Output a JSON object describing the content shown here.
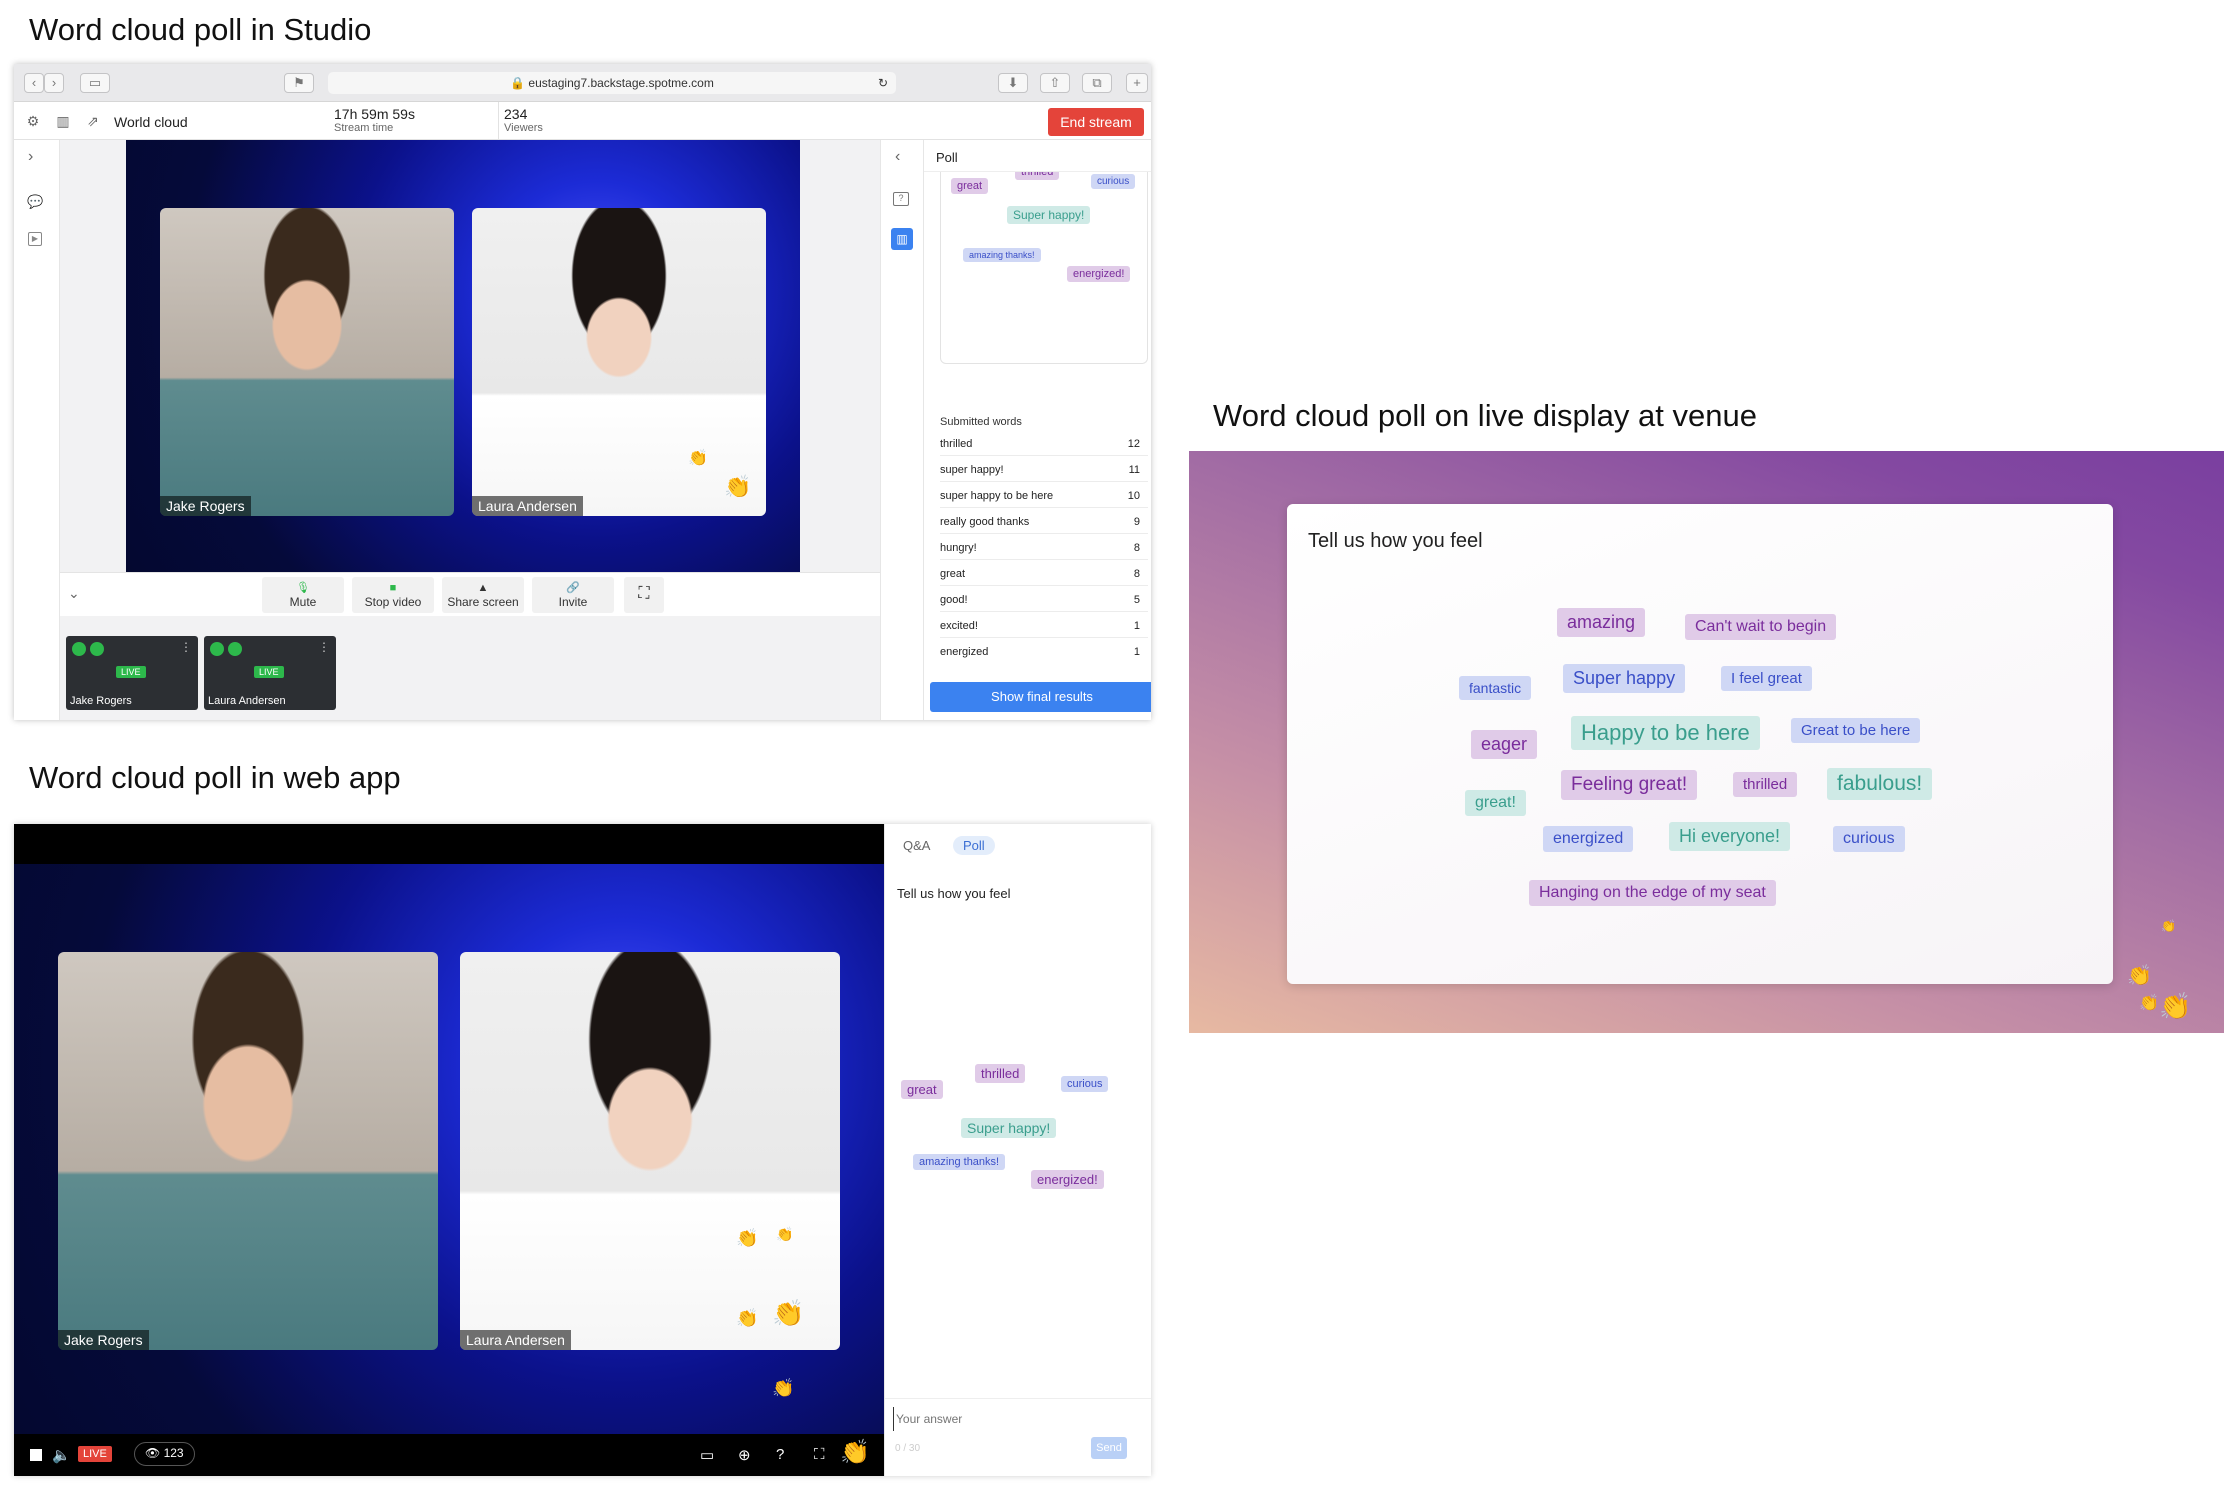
{
  "titles": {
    "studio": "Word cloud poll in Studio",
    "webapp": "Word cloud poll in web app",
    "venue": "Word cloud poll on live display at venue"
  },
  "studio": {
    "url": "eustaging7.backstage.spotme.com",
    "page_title": "World cloud",
    "stream_time": "17h 59m 59s",
    "stream_time_label": "Stream time",
    "viewers": "234",
    "viewers_label": "Viewers",
    "end_stream": "End stream",
    "participants": [
      "Jake Rogers",
      "Laura Andersen"
    ],
    "controls": {
      "mute": "Mute",
      "stop_video": "Stop video",
      "share_screen": "Share screen",
      "invite": "Invite"
    },
    "live_badge": "LIVE",
    "panel_title": "Poll",
    "cloud_words": [
      "great",
      "thrilled",
      "curious",
      "Super happy!",
      "amazing thanks!",
      "energized!"
    ],
    "submitted_header": "Submitted words",
    "submitted": [
      {
        "word": "thrilled",
        "count": "12"
      },
      {
        "word": "super happy!",
        "count": "11"
      },
      {
        "word": "super happy to be here",
        "count": "10"
      },
      {
        "word": "really good thanks",
        "count": "9"
      },
      {
        "word": "hungry!",
        "count": "8"
      },
      {
        "word": "great",
        "count": "8"
      },
      {
        "word": "good!",
        "count": "5"
      },
      {
        "word": "excited!",
        "count": "1"
      },
      {
        "word": "energized",
        "count": "1"
      }
    ],
    "final_button": "Show final results"
  },
  "webapp": {
    "participants": [
      "Jake Rogers",
      "Laura Andersen"
    ],
    "live_badge": "LIVE",
    "viewer_count": "123",
    "tabs": [
      "Q&A",
      "Poll"
    ],
    "question": "Tell us how you feel",
    "cloud_words": [
      "great",
      "thrilled",
      "curious",
      "Super happy!",
      "amazing thanks!",
      "energized!"
    ],
    "answer_placeholder": "Your answer",
    "char_count": "0 / 30",
    "send": "Send"
  },
  "venue": {
    "question": "Tell us how you feel",
    "words": [
      "amazing",
      "Can't wait to begin",
      "fantastic",
      "Super happy",
      "I feel great",
      "eager",
      "Happy to be here",
      "Great to be here",
      "great!",
      "Feeling great!",
      "thrilled",
      "fabulous!",
      "energized",
      "Hi everyone!",
      "curious",
      "Hanging on the edge of my seat"
    ]
  },
  "colors": {
    "purple": "#7a2d9c",
    "blue": "#3a4fc8",
    "teal": "#3a9e8d",
    "accent": "#3b82f0",
    "end_red": "#e4443a",
    "live_green": "#2db84b"
  },
  "icons": [
    "settings-icon",
    "chart-icon",
    "external-link-icon",
    "chevron-right-icon",
    "chevron-left-icon",
    "chevron-down-icon",
    "qa-icon",
    "poll-icon",
    "microphone-icon",
    "camera-icon",
    "share-screen-icon",
    "link-icon",
    "fullscreen-icon",
    "eye-icon",
    "globe-icon",
    "help-icon",
    "clap-icon"
  ]
}
